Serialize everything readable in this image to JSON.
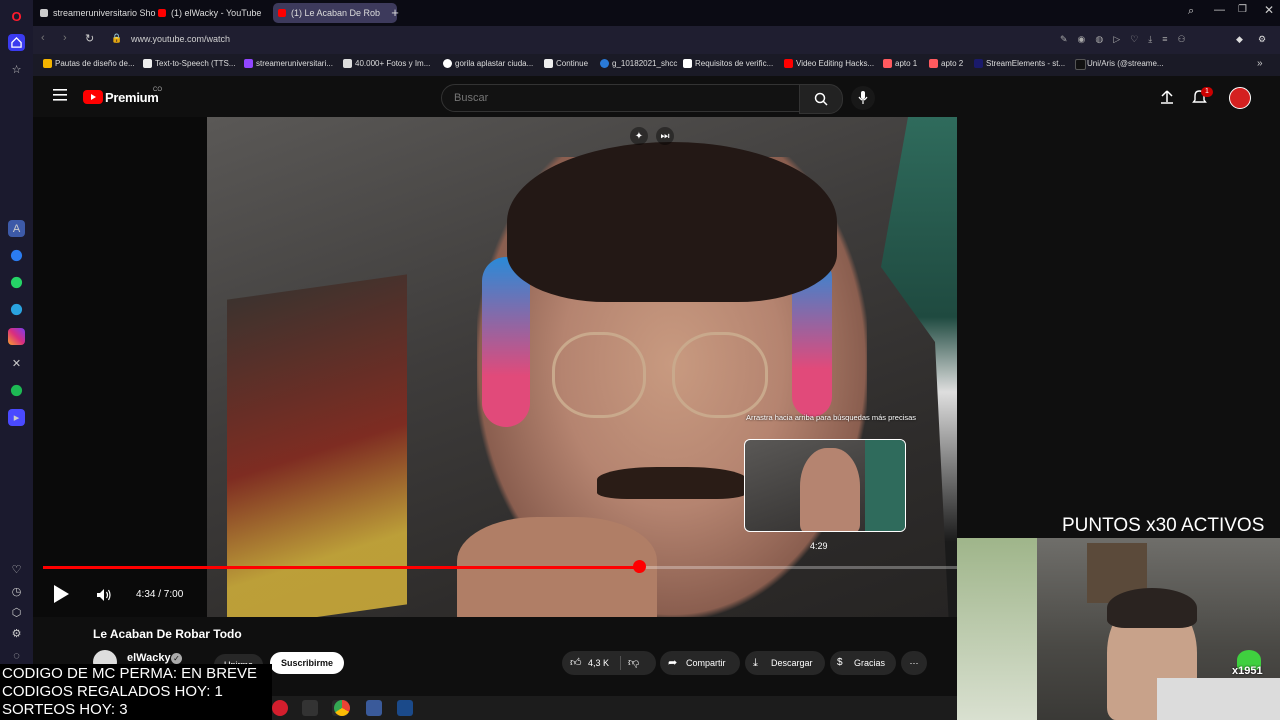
{
  "browser": {
    "tabs": [
      {
        "title": "streameruniversitario Sho",
        "active": false
      },
      {
        "title": "(1) elWacky - YouTube",
        "active": false
      },
      {
        "title": "(1) Le Acaban De Rob",
        "active": true
      }
    ],
    "url": "www.youtube.com/watch",
    "bookmarks": [
      "Pautas de diseño de...",
      "Text-to-Speech (TTS...",
      "streameruniversitari...",
      "40.000+ Fotos y Im...",
      "gorila aplastar ciuda...",
      "Continue",
      "g_10182021_shcc",
      "Requisitos de verific...",
      "Video Editing Hacks...",
      "apto 1",
      "apto 2",
      "StreamElements - st...",
      "Uni/Aris (@streame..."
    ]
  },
  "youtube": {
    "logo_text": "Premium",
    "logo_sup": "CO",
    "search_placeholder": "Buscar",
    "notification_count": "1"
  },
  "video": {
    "tooltip": "Arrastra hacia arriba para búsquedas más precisas",
    "hover_time": "4:29",
    "time_display": "4:34 / 7:00",
    "progress_fraction": 0.6524
  },
  "meta": {
    "title": "Le Acaban De Robar Todo",
    "channel": "elWacky",
    "join_label": "Unirme",
    "subscribe_label": "Suscribirme",
    "likes": "4,3 K",
    "share_label": "Compartir",
    "download_label": "Descargar",
    "thanks_label": "Gracias"
  },
  "stream_overlay": {
    "lines": [
      "CODIGO DE MC PERMA: EN BREVE",
      "CODIGOS REGALADOS HOY: 1",
      "SORTEOS HOY: 3"
    ],
    "puntos": "PUNTOS x30 ACTIVOS",
    "badge": "x1951"
  }
}
